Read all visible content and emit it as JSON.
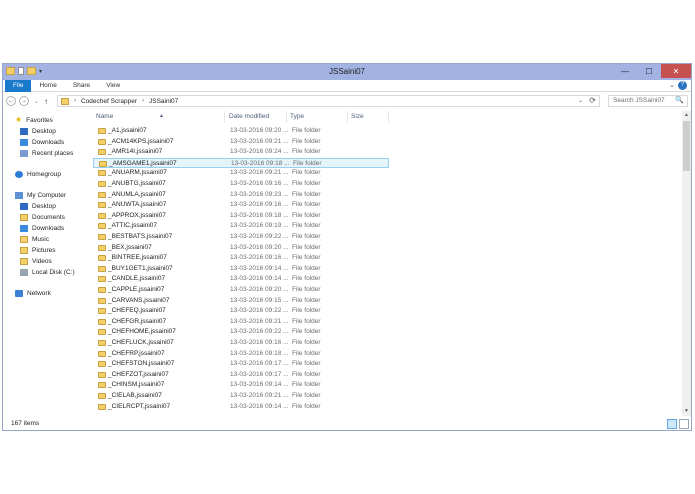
{
  "window": {
    "title": "JSSaini07"
  },
  "window_buttons": {
    "minimize": "—",
    "maximize": "☐",
    "close": "✕"
  },
  "ribbon": {
    "tabs": [
      "File",
      "Home",
      "Share",
      "View"
    ],
    "help": "?",
    "expand": "⌄"
  },
  "nav_buttons": {
    "back": "←",
    "forward": "→",
    "recent": "⌄",
    "up": "↑"
  },
  "address": {
    "crumbs": [
      "Codechef Scrapper",
      "JSSaini07"
    ],
    "separator": "›",
    "dropdown": "⌄",
    "refresh": "⟳"
  },
  "search": {
    "placeholder": "Search JSSaini07",
    "icon": "🔍"
  },
  "sidebar": {
    "items": [
      {
        "label": "Favorites",
        "icon": "star"
      },
      {
        "label": "Desktop",
        "icon": "desktop"
      },
      {
        "label": "Downloads",
        "icon": "dl"
      },
      {
        "label": "Recent places",
        "icon": "recent"
      },
      {
        "label": "Homegroup",
        "icon": "home"
      },
      {
        "label": "My Computer",
        "icon": "pc"
      },
      {
        "label": "Desktop",
        "icon": "desktop"
      },
      {
        "label": "Documents",
        "icon": "folder"
      },
      {
        "label": "Downloads",
        "icon": "dl"
      },
      {
        "label": "Music",
        "icon": "folder"
      },
      {
        "label": "Pictures",
        "icon": "folder"
      },
      {
        "label": "Videos",
        "icon": "folder"
      },
      {
        "label": "Local Disk (C:)",
        "icon": "drive"
      },
      {
        "label": "Network",
        "icon": "net"
      }
    ]
  },
  "columns": {
    "name": "Name",
    "date": "Date modified",
    "type": "Type",
    "size": "Size"
  },
  "files": [
    {
      "name": "_A1,jssaini07",
      "date": "13-03-2016 09:20 ...",
      "type": "File folder"
    },
    {
      "name": "_ACM14KPS,jssaini07",
      "date": "13-03-2016 09:21 ...",
      "type": "File folder"
    },
    {
      "name": "_AMR14I,jssaini07",
      "date": "13-03-2016 09:24 ...",
      "type": "File folder"
    },
    {
      "name": "_AMSGAME1,jssaini07",
      "date": "13-03-2016 09:18 ...",
      "type": "File folder",
      "selected": true
    },
    {
      "name": "_ANUARM,jssaini07",
      "date": "13-03-2016 09:21 ...",
      "type": "File folder"
    },
    {
      "name": "_ANUBTG,jssaini07",
      "date": "13-03-2016 09:16 ...",
      "type": "File folder"
    },
    {
      "name": "_ANUMLA,jssaini07",
      "date": "13-03-2016 09:23 ...",
      "type": "File folder"
    },
    {
      "name": "_ANUWTA,jssaini07",
      "date": "13-03-2016 09:16 ...",
      "type": "File folder"
    },
    {
      "name": "_APPROX,jssaini07",
      "date": "13-03-2016 09:18 ...",
      "type": "File folder"
    },
    {
      "name": "_ATTIC,jssaini07",
      "date": "13-03-2016 09:19 ...",
      "type": "File folder"
    },
    {
      "name": "_BESTBATS,jssaini07",
      "date": "13-03-2016 09:22 ...",
      "type": "File folder"
    },
    {
      "name": "_BEX,jssaini07",
      "date": "13-03-2016 09:20 ...",
      "type": "File folder"
    },
    {
      "name": "_BINTREE,jssaini07",
      "date": "13-03-2016 09:16 ...",
      "type": "File folder"
    },
    {
      "name": "_BUY1GET1,jssaini07",
      "date": "13-03-2016 09:14 ...",
      "type": "File folder"
    },
    {
      "name": "_CANDLE,jssaini07",
      "date": "13-03-2016 09:14 ...",
      "type": "File folder"
    },
    {
      "name": "_CAPPLE,jssaini07",
      "date": "13-03-2016 09:20 ...",
      "type": "File folder"
    },
    {
      "name": "_CARVANS,jssaini07",
      "date": "13-03-2016 09:15 ...",
      "type": "File folder"
    },
    {
      "name": "_CHEFEQ,jssaini07",
      "date": "13-03-2016 09:22 ...",
      "type": "File folder"
    },
    {
      "name": "_CHEFGR,jssaini07",
      "date": "13-03-2016 09:21 ...",
      "type": "File folder"
    },
    {
      "name": "_CHEFHOME,jssaini07",
      "date": "13-03-2016 09:22 ...",
      "type": "File folder"
    },
    {
      "name": "_CHEFLUCK,jssaini07",
      "date": "13-03-2016 09:16 ...",
      "type": "File folder"
    },
    {
      "name": "_CHEFRP,jssaini07",
      "date": "13-03-2016 09:18 ...",
      "type": "File folder"
    },
    {
      "name": "_CHEFSTON,jssaini07",
      "date": "13-03-2016 09:17 ...",
      "type": "File folder"
    },
    {
      "name": "_CHEFZOT,jssaini07",
      "date": "13-03-2016 09:17 ...",
      "type": "File folder"
    },
    {
      "name": "_CHINSM,jssaini07",
      "date": "13-03-2016 09:14 ...",
      "type": "File folder"
    },
    {
      "name": "_CIELAB,jssaini07",
      "date": "13-03-2016 09:21 ...",
      "type": "File folder"
    },
    {
      "name": "_CIELRCPT,jssaini07",
      "date": "13-03-2016 09:14 ...",
      "type": "File folder"
    }
  ],
  "status": {
    "count": "167 items"
  }
}
